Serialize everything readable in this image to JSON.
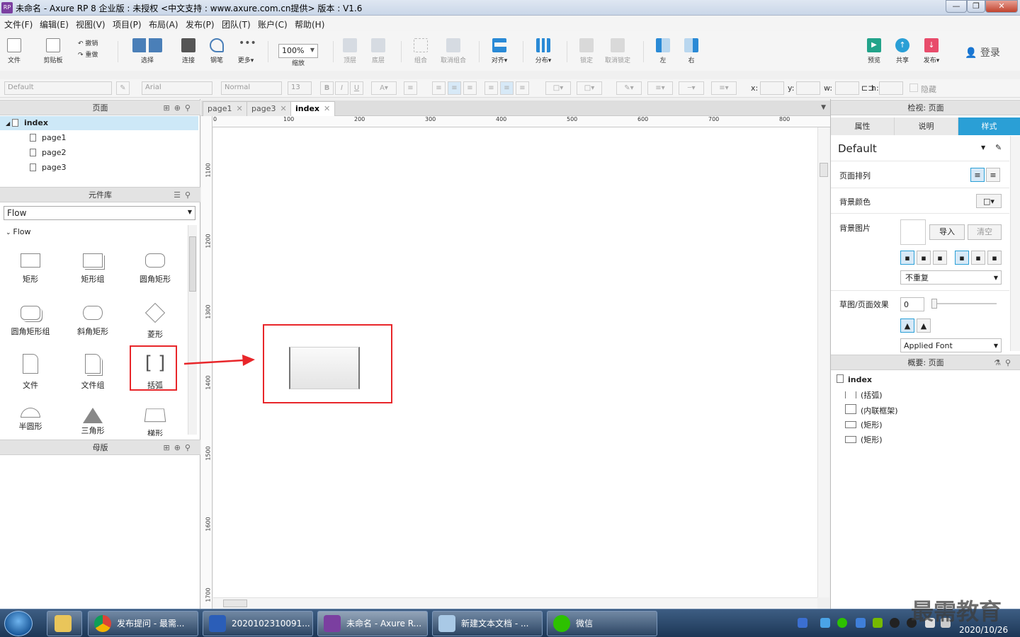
{
  "window": {
    "title": "未命名 - Axure RP 8 企业版 : 未授权      <中文支持 : www.axure.com.cn提供> 版本 : V1.6",
    "logo": "RP",
    "controls": [
      "—",
      "❐",
      "✕"
    ]
  },
  "menu": [
    "文件(F)",
    "编辑(E)",
    "视图(V)",
    "项目(P)",
    "布局(A)",
    "发布(P)",
    "团队(T)",
    "账户(C)",
    "帮助(H)"
  ],
  "toolbar": {
    "file": "文件",
    "clipboard": "剪贴板",
    "undo": "撤销",
    "redo": "重做",
    "select": "选择",
    "connect": "连接",
    "pen": "钢笔",
    "more": "更多▾",
    "zoom_value": "100%",
    "zoom_label": "缩放",
    "top": "顶层",
    "bottom": "底层",
    "group": "组合",
    "ungroup": "取消组合",
    "align": "对齐▾",
    "distribute": "分布▾",
    "lock": "锁定",
    "unlock": "取消锁定",
    "left": "左",
    "right": "右",
    "preview": "预览",
    "share": "共享",
    "publish": "发布▾",
    "login": "登录"
  },
  "format": {
    "style": "Default",
    "font": "Arial",
    "weight": "Normal",
    "size": "13",
    "x_label": "x:",
    "y_label": "y:",
    "w_label": "w:",
    "h_label": "h:",
    "hidden_label": "隐藏"
  },
  "pages_panel": {
    "title": "页面",
    "items": [
      {
        "label": "index",
        "level": 0,
        "selected": true
      },
      {
        "label": "page1",
        "level": 1
      },
      {
        "label": "page2",
        "level": 1
      },
      {
        "label": "page3",
        "level": 1
      }
    ]
  },
  "library_panel": {
    "title": "元件库",
    "selected_library": "Flow",
    "section": "Flow",
    "widgets": [
      "矩形",
      "矩形组",
      "圆角矩形",
      "圆角矩形组",
      "斜角矩形",
      "菱形",
      "文件",
      "文件组",
      "括弧",
      "半圆形",
      "三角形",
      "梯形"
    ]
  },
  "masters_panel": {
    "title": "母版"
  },
  "canvas": {
    "tabs": [
      "page1",
      "page3",
      "index"
    ],
    "active_tab": "index",
    "ruler_h": [
      "0",
      "100",
      "200",
      "300",
      "400",
      "500",
      "600",
      "700",
      "800"
    ],
    "ruler_v": [
      "1100",
      "1200",
      "1300",
      "1400",
      "1500",
      "1600",
      "1700"
    ]
  },
  "inspector": {
    "title": "检视: 页面",
    "tabs": [
      "属性",
      "说明",
      "样式"
    ],
    "active_tab": "样式",
    "style_name": "Default",
    "page_align": "页面排列",
    "bg_color": "背景颜色",
    "bg_image": "背景图片",
    "import_btn": "导入",
    "clear_btn": "清空",
    "repeat": "不重复",
    "sketch": "草图/页面效果",
    "sketch_value": "0",
    "applied_font": "Applied Font"
  },
  "outline": {
    "title": "概要: 页面",
    "root": "index",
    "items": [
      "(括弧)",
      "(内联框架)",
      "(矩形)",
      "(矩形)"
    ]
  },
  "taskbar": {
    "items": [
      "发布提问 - 最需...",
      "2020102310091...",
      "未命名 - Axure R...",
      "新建文本文档 - ...",
      "微信"
    ],
    "date": "2020/10/26",
    "watermark": "最需教育"
  },
  "colors": {
    "accent": "#2a9fd6",
    "annotation": "#e8262a",
    "selection": "#cde8f7"
  }
}
